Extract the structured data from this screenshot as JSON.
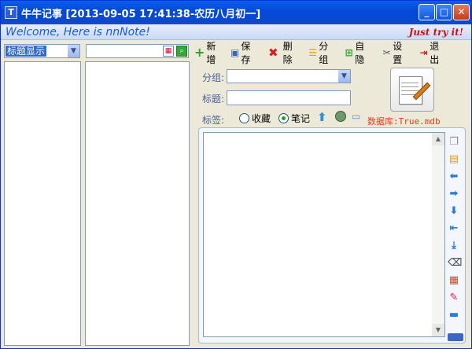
{
  "window": {
    "icon_letter": "T",
    "title": "牛牛记事 [2013-09-05 17:41:38-农历八月初一]",
    "controls": {
      "minimize": "_",
      "maximize": "□",
      "close": "✕"
    }
  },
  "banner": {
    "welcome": "Welcome, Here is nnNote!",
    "slogan": "Just try it!"
  },
  "left": {
    "display_mode": "标题显示",
    "search_value": ""
  },
  "toolbar": {
    "add": "新增",
    "save": "保存",
    "delete": "删除",
    "group": "分组",
    "hide": "自隐",
    "settings": "设置",
    "exit": "退出"
  },
  "form": {
    "group_label": "分组:",
    "group_value": "",
    "title_label": "标题:",
    "title_value": "",
    "tag_label": "标签:",
    "tag_favorite": "收藏",
    "tag_note": "笔记",
    "selected_tag": "笔记",
    "database_label": "数据库:True.mdb"
  },
  "colors": {
    "titlebar": "#0548d8",
    "banner_text": "#1c5bd6",
    "slogan": "#c81414",
    "database": "#e23b1b"
  },
  "icons": {
    "editor_side": [
      "copy-icon",
      "paste-icon",
      "arrow-left-icon",
      "arrow-right-icon",
      "arrow-down-icon",
      "first-icon",
      "last-icon",
      "delete-small-icon",
      "calendar-icon",
      "dropper-icon",
      "minus-icon"
    ]
  }
}
